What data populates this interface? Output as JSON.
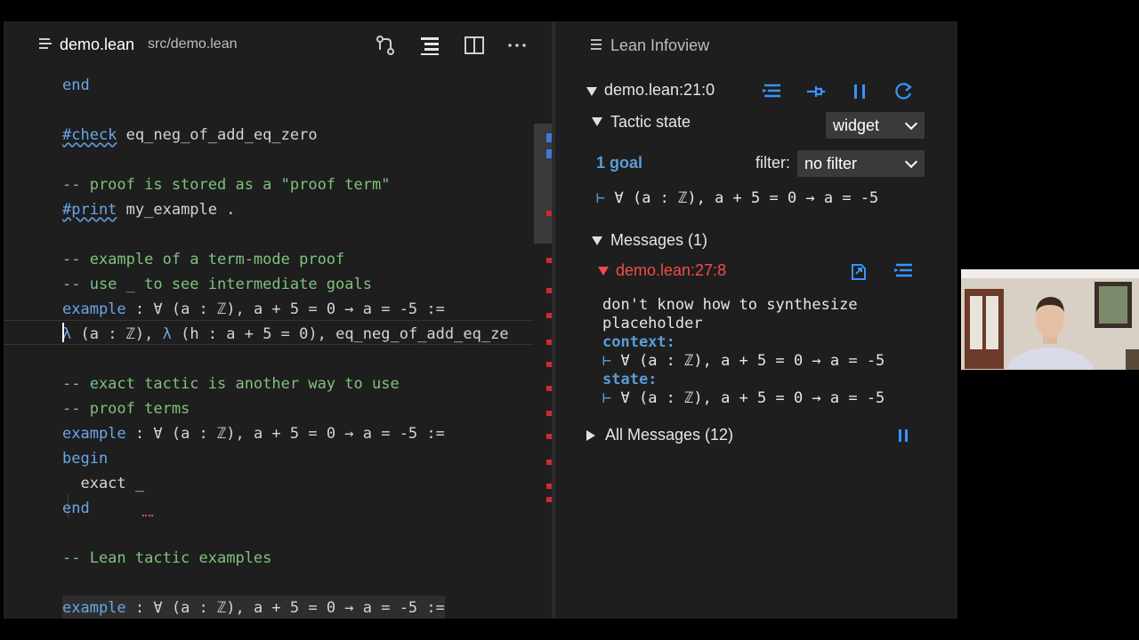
{
  "editor": {
    "tab": {
      "filename": "demo.lean",
      "path": "src/demo.lean"
    },
    "toolbar": [
      "source-control-icon",
      "outline-icon",
      "split-editor-icon",
      "more-actions-icon"
    ],
    "lines": {
      "l1": "end",
      "l2_kw": "#check",
      "l2_rest": " eq_neg_of_add_eq_zero",
      "l3": "-- proof is stored as a \"proof term\"",
      "l4_kw": "#print",
      "l4_rest": " my_example .",
      "l5": "-- example of a term-mode proof",
      "l6": "-- use _ to see intermediate goals",
      "l7_kw": "example",
      "l7_rest": " : ∀ (a : ℤ), a + 5 = 0 → a = -5 :=",
      "l8_lambda1": "λ",
      "l8_mid": " (a : ℤ), ",
      "l8_lambda2": "λ",
      "l8_rest": " (h : a + 5 = 0), eq_neg_of_add_eq_ze",
      "l9": "-- exact tactic is another way to use",
      "l10": "-- proof terms",
      "l11_kw": "example",
      "l11_rest": " : ∀ (a : ℤ), a + 5 = 0 → a = -5 :=",
      "l12": "begin",
      "l13": "  exact _",
      "l14": "end",
      "l15": "-- Lean tactic examples",
      "l16_kw": "example",
      "l16_rest": " : ∀ (a : ℤ), a + 5 = 0 → a = -5 :="
    }
  },
  "infoview": {
    "title": "Lean Infoview",
    "position": "demo.lean:21:0",
    "tactic_state_label": "Tactic state",
    "display_mode": "widget",
    "goal_count": "1 goal",
    "filter_label": "filter:",
    "filter_value": "no filter",
    "goal": {
      "turnstile": "⊢",
      "text": " ∀ (a : ℤ), a + 5 = 0 → a = -5"
    },
    "messages_label": "Messages (1)",
    "message": {
      "location": "demo.lean:27:8",
      "line1": "don't know how to synthesize",
      "line2": "placeholder",
      "context_label": "context:",
      "context_goal": " ∀ (a : ℤ), a + 5 = 0 → a = -5",
      "state_label": "state:",
      "state_goal": " ∀ (a : ℤ), a + 5 = 0 → a = -5"
    },
    "all_messages_label": "All Messages (12)"
  },
  "colors": {
    "keyword": "#6aa6e8",
    "comment": "#7ec27e",
    "error": "#f14c4c",
    "accent": "#3794ff",
    "background": "#1e1e1e"
  }
}
